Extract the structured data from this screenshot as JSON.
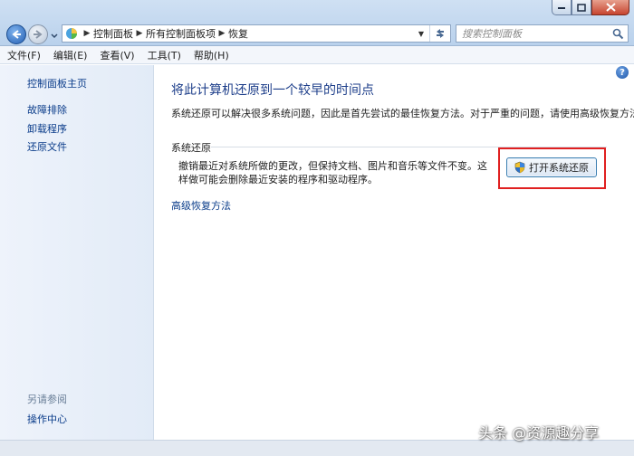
{
  "address_bar": {
    "crumbs": [
      "控制面板",
      "所有控制面板项",
      "恢复"
    ],
    "icon": "control-panel-icon"
  },
  "search": {
    "placeholder": "搜索控制面板"
  },
  "menu": [
    "文件(F)",
    "编辑(E)",
    "查看(V)",
    "工具(T)",
    "帮助(H)"
  ],
  "sidebar": {
    "home": "控制面板主页",
    "links": [
      "故障排除",
      "卸载程序",
      "还原文件"
    ],
    "see_also_label": "另请参阅",
    "see_also_links": [
      "操作中心"
    ]
  },
  "main": {
    "title": "将此计算机还原到一个较早的时间点",
    "intro": "系统还原可以解决很多系统问题，因此是首先尝试的最佳恢复方法。对于严重的问题，请使用高级恢复方法。",
    "system_restore": {
      "heading": "系统还原",
      "description": "撤销最近对系统所做的更改，但保持文档、图片和音乐等文件不变。这样做可能会删除最近安装的程序和驱动程序。",
      "button_label": "打开系统还原",
      "button_icon": "uac-shield-icon"
    },
    "advanced_link": "高级恢复方法"
  },
  "watermark": "头条 @资源趣分享",
  "colors": {
    "link": "#0a3c8a",
    "title": "#1d3e8a",
    "highlight_frame": "#e02020",
    "left_pane": "#e8eff9"
  }
}
